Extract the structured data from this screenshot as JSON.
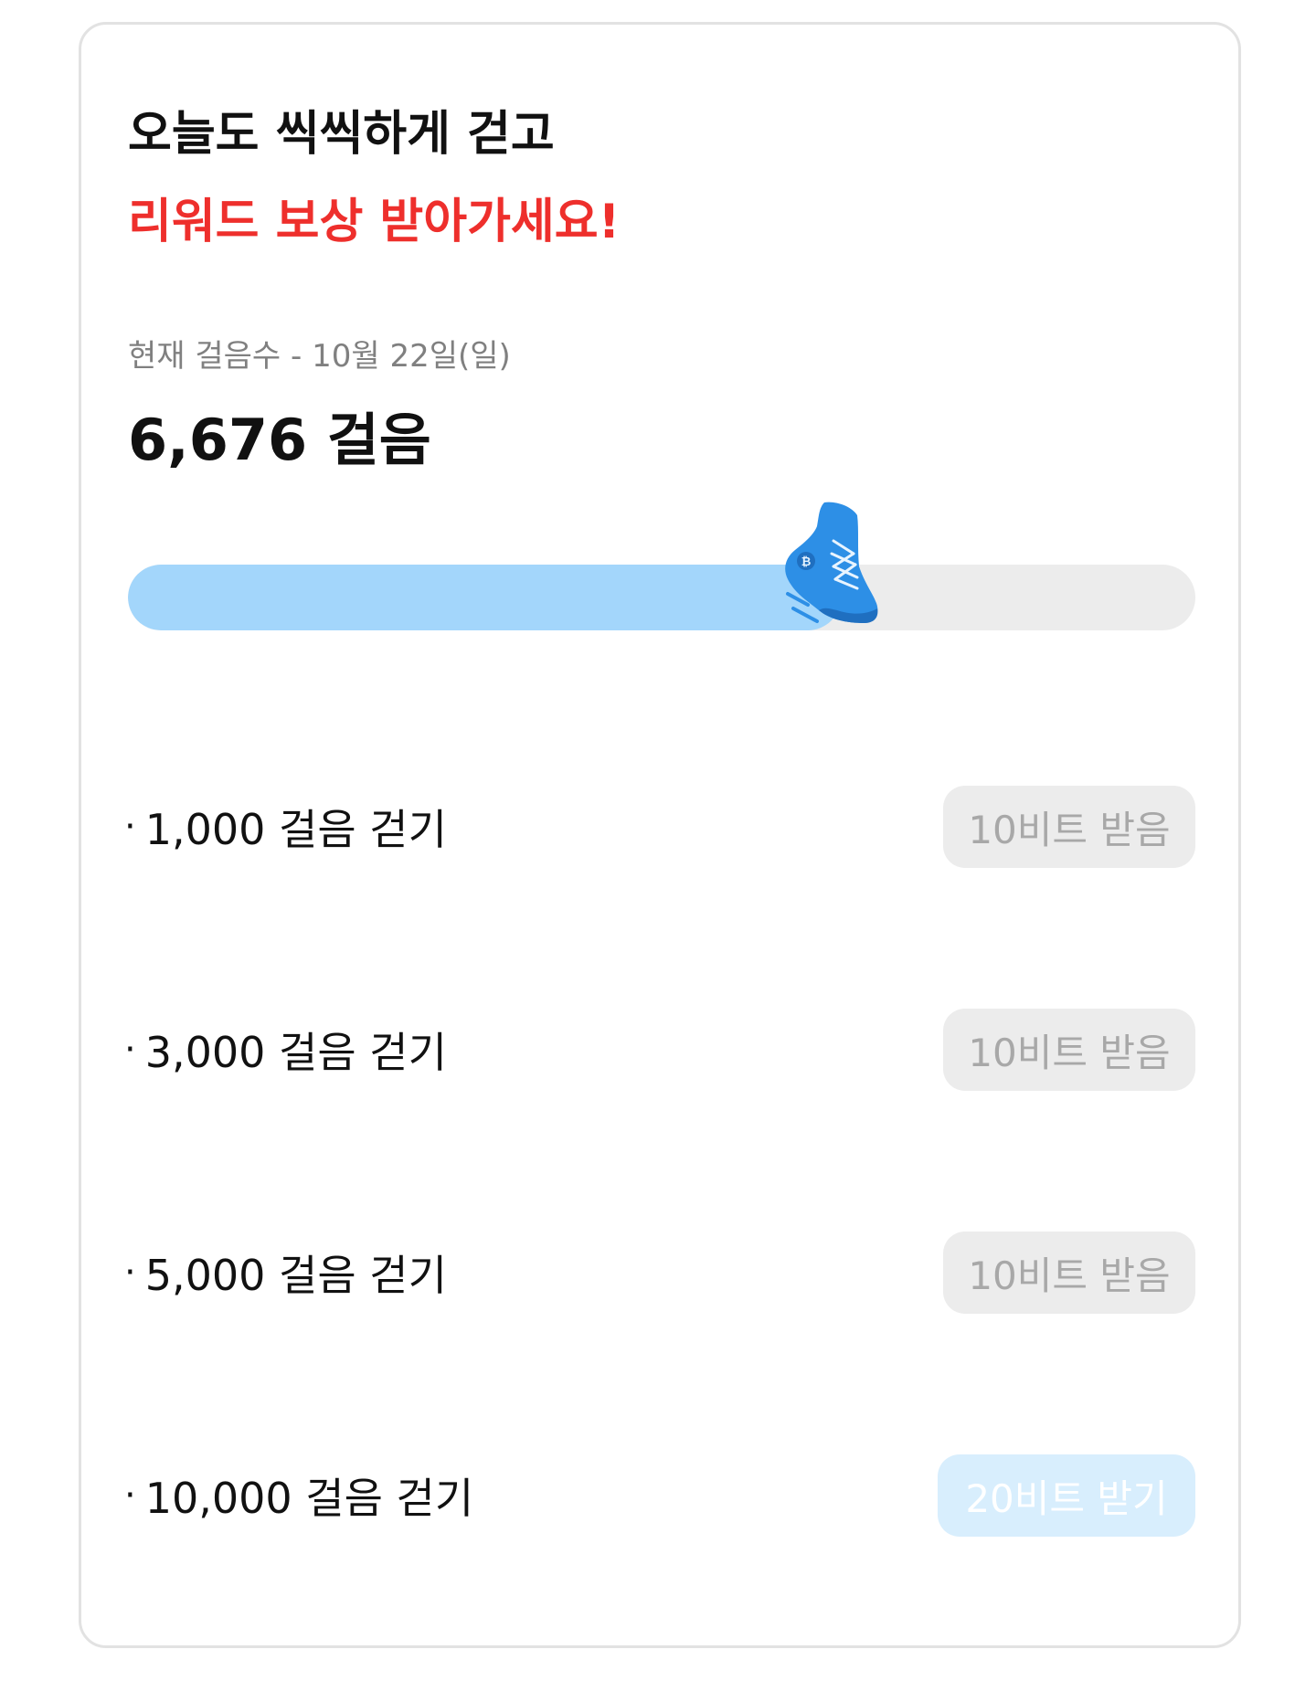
{
  "header": {
    "line1": "오늘도 씩씩하게 걷고",
    "line2": "리워드 보상 받아가세요!"
  },
  "steps": {
    "caption": "현재 걸음수 - 10월 22일(일)",
    "count_label": "6,676 걸음",
    "count": 6676,
    "goal": 10000,
    "progress_fraction": 0.6676
  },
  "progress_icon": "sneaker-bitcoin-icon",
  "colors": {
    "accent_red": "#ee2f2c",
    "progress_fill": "#a3d6fb",
    "progress_track": "#ececec",
    "shoe_blue": "#2d8fe6",
    "received_button_bg": "#ececec",
    "claim_button_bg": "#d8eefd"
  },
  "missions": [
    {
      "bullet": "·",
      "label": "1,000 걸음 걷기",
      "button": "10비트 받음",
      "state": "received"
    },
    {
      "bullet": "·",
      "label": "3,000 걸음 걷기",
      "button": "10비트 받음",
      "state": "received"
    },
    {
      "bullet": "·",
      "label": "5,000 걸음 걷기",
      "button": "10비트 받음",
      "state": "received"
    },
    {
      "bullet": "·",
      "label": "10,000 걸음 걷기",
      "button": "20비트 받기",
      "state": "claim"
    }
  ]
}
